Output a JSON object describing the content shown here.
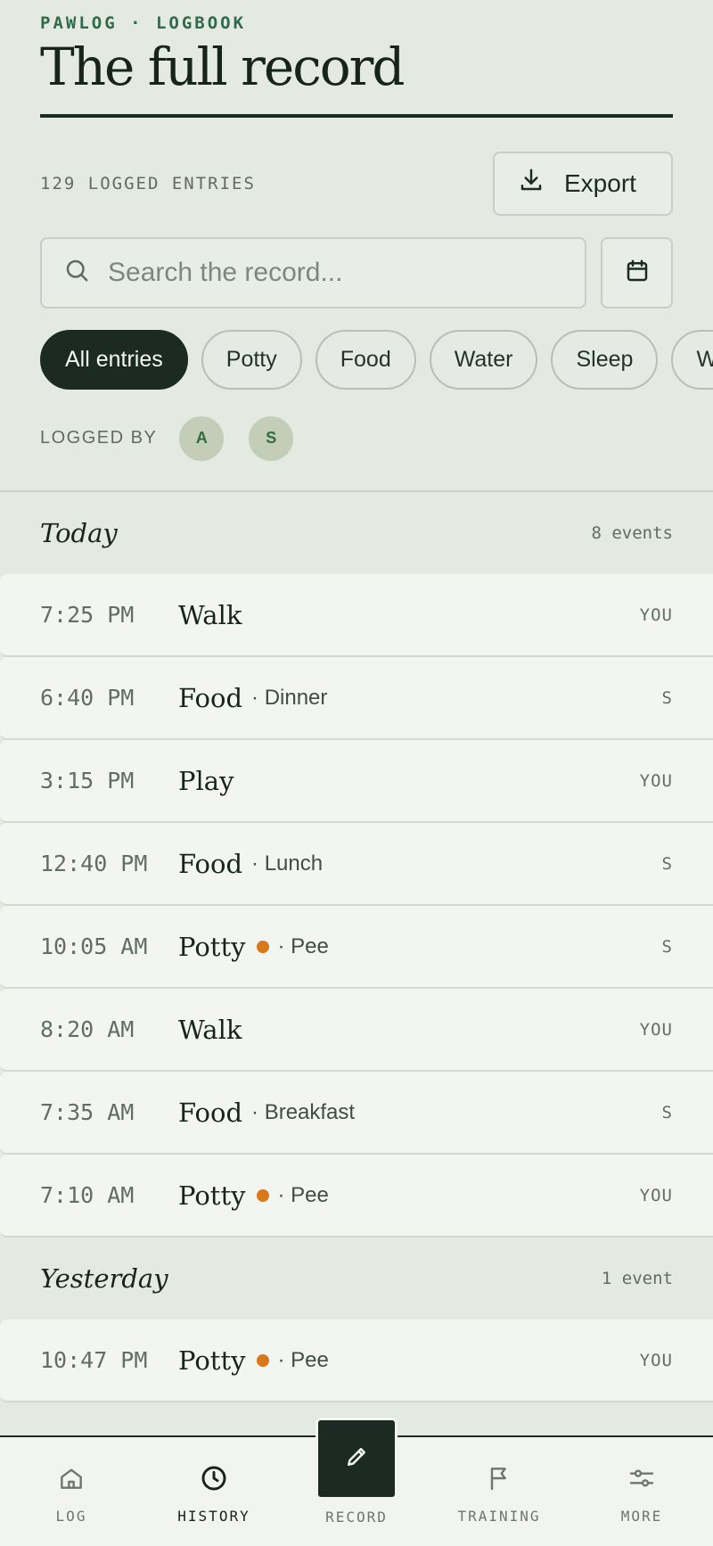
{
  "header": {
    "eyebrow": "PAWLOG · LOGBOOK",
    "title": "The full record"
  },
  "meta": {
    "entry_count": "129 LOGGED ENTRIES",
    "export_label": "Export"
  },
  "search": {
    "placeholder": "Search the record..."
  },
  "filters": [
    "All entries",
    "Potty",
    "Food",
    "Water",
    "Sleep",
    "W"
  ],
  "logged_by": {
    "label": "LOGGED BY",
    "avatars": [
      "A",
      "S"
    ]
  },
  "sections": [
    {
      "title": "Today",
      "count": "8 events",
      "entries": [
        {
          "time": "7:25 PM",
          "type": "Walk",
          "detail": "",
          "who": "YOU",
          "dot": false
        },
        {
          "time": "6:40 PM",
          "type": "Food",
          "detail": "· Dinner",
          "who": "S",
          "dot": false
        },
        {
          "time": "3:15 PM",
          "type": "Play",
          "detail": "",
          "who": "YOU",
          "dot": false
        },
        {
          "time": "12:40 PM",
          "type": "Food",
          "detail": "· Lunch",
          "who": "S",
          "dot": false
        },
        {
          "time": "10:05 AM",
          "type": "Potty",
          "detail": "· Pee",
          "who": "S",
          "dot": true
        },
        {
          "time": "8:20 AM",
          "type": "Walk",
          "detail": "",
          "who": "YOU",
          "dot": false
        },
        {
          "time": "7:35 AM",
          "type": "Food",
          "detail": "· Breakfast",
          "who": "S",
          "dot": false
        },
        {
          "time": "7:10 AM",
          "type": "Potty",
          "detail": "· Pee",
          "who": "YOU",
          "dot": true
        }
      ]
    },
    {
      "title": "Yesterday",
      "count": "1 event",
      "entries": [
        {
          "time": "10:47 PM",
          "type": "Potty",
          "detail": "· Pee",
          "who": "YOU",
          "dot": true
        }
      ]
    }
  ],
  "nav": {
    "log": "LOG",
    "history": "HISTORY",
    "record": "RECORD",
    "training": "TRAINING",
    "more": "MORE"
  },
  "colors": {
    "accent_dark": "#1b2a22",
    "accent_green": "#2f6b49",
    "potty_dot": "#d9771b",
    "background": "#e4e9e2"
  }
}
